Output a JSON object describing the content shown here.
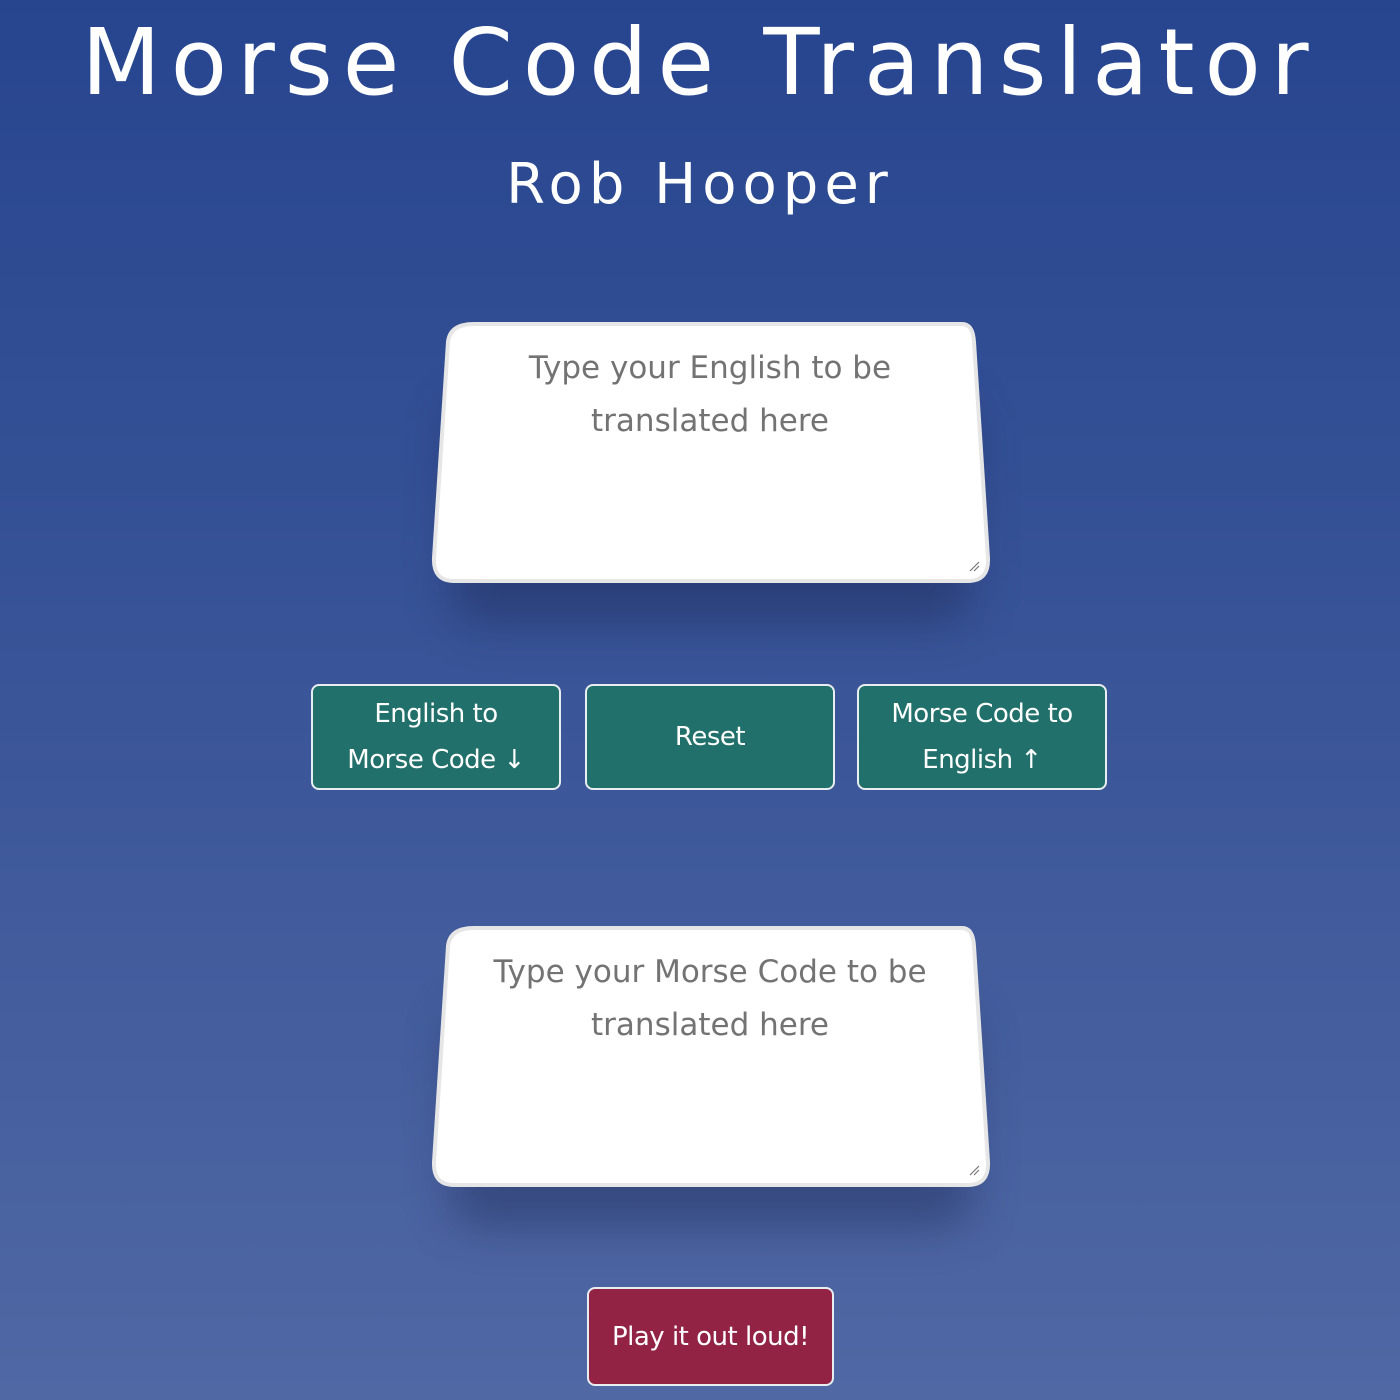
{
  "header": {
    "title": "Morse Code Translator",
    "author": "Rob Hooper"
  },
  "english_input": {
    "placeholder": "Type your English to be translated here",
    "value": ""
  },
  "morse_input": {
    "placeholder": "Type your Morse Code to be translated here",
    "value": ""
  },
  "buttons": {
    "english_to_morse": {
      "line1": "English to",
      "line2": "Morse Code",
      "arrow": "↓"
    },
    "reset": "Reset",
    "morse_to_english": {
      "line1": "Morse Code to",
      "line2": "English",
      "arrow": "↑"
    },
    "play": "Play it out loud!"
  },
  "colors": {
    "background_top": "#27458f",
    "background_bottom": "#5068a4",
    "translate_button": "#22706b",
    "play_button": "#922345"
  }
}
